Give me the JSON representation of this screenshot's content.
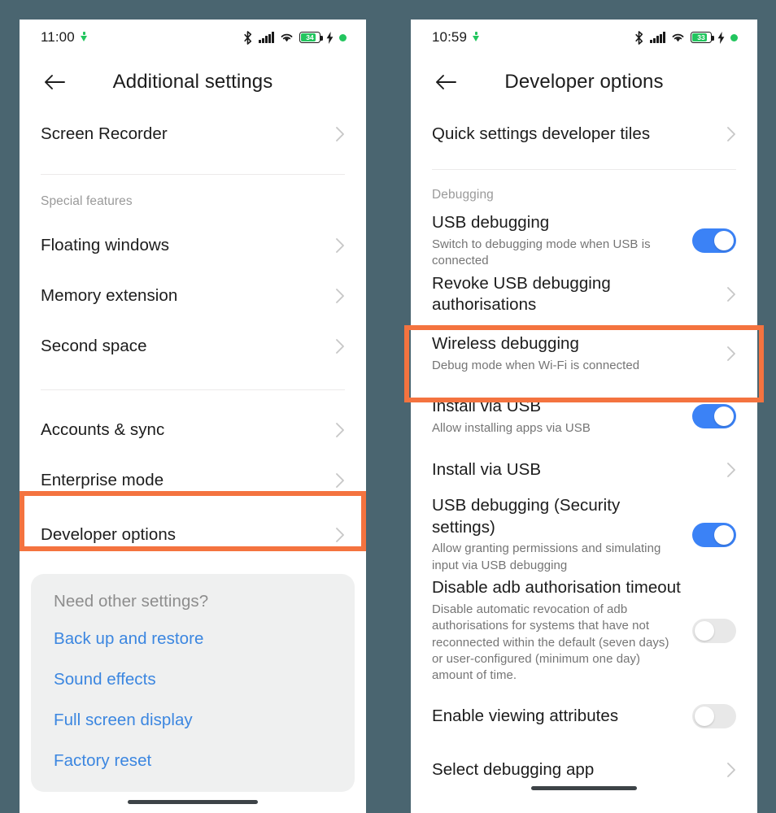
{
  "theme": {
    "background": "#4a6570",
    "panel": "#ffffff",
    "highlight": "#f4733f",
    "toggle_on": "#3b82f6",
    "toggle_off": "#e8e8e8",
    "link": "#3b86e0",
    "battery_fill": "#22c55e"
  },
  "left_phone": {
    "statusbar": {
      "time": "11:00",
      "download_icon": "download-arrow-icon",
      "bluetooth_icon": "bluetooth-icon",
      "signal_icon": "cellular-signal-icon",
      "wifi_icon": "wifi-icon",
      "battery_level": "34",
      "charging_icon": "lightning-bolt-icon",
      "status_dot": "green-dot-icon"
    },
    "appbar": {
      "back_icon": "back-arrow-icon",
      "title": "Additional settings"
    },
    "rows_top": [
      {
        "title": "Screen Recorder",
        "chevron": "chevron-right-icon"
      }
    ],
    "section_label": "Special features",
    "rows_special": [
      {
        "title": "Floating windows",
        "chevron": "chevron-right-icon"
      },
      {
        "title": "Memory extension",
        "chevron": "chevron-right-icon"
      },
      {
        "title": "Second space",
        "chevron": "chevron-right-icon"
      }
    ],
    "rows_bottom": [
      {
        "title": "Accounts & sync",
        "chevron": "chevron-right-icon"
      },
      {
        "title": "Enterprise mode",
        "chevron": "chevron-right-icon"
      },
      {
        "title": "Developer options",
        "chevron": "chevron-right-icon",
        "highlighted": true
      }
    ],
    "need_card": {
      "title": "Need other settings?",
      "links": [
        "Back up and restore",
        "Sound effects",
        "Full screen display",
        "Factory reset"
      ]
    }
  },
  "right_phone": {
    "statusbar": {
      "time": "10:59",
      "download_icon": "download-arrow-icon",
      "bluetooth_icon": "bluetooth-icon",
      "signal_icon": "cellular-signal-icon",
      "wifi_icon": "wifi-icon",
      "battery_level": "33",
      "charging_icon": "lightning-bolt-icon",
      "status_dot": "green-dot-icon"
    },
    "appbar": {
      "back_icon": "back-arrow-icon",
      "title": "Developer options"
    },
    "rows_top": [
      {
        "title": "Quick settings developer tiles",
        "control": "chevron"
      }
    ],
    "section_label": "Debugging",
    "rows_debug": [
      {
        "title": "USB debugging",
        "subtitle": "Switch to debugging mode when USB is connected",
        "control": "toggle",
        "toggle_state": "on"
      },
      {
        "title": "Revoke USB debugging authorisations",
        "subtitle": "",
        "control": "chevron"
      },
      {
        "title": "Wireless debugging",
        "subtitle": "Debug mode when Wi-Fi is connected",
        "control": "chevron",
        "highlighted": true
      },
      {
        "title": "Install via USB",
        "subtitle": "Allow installing apps via USB",
        "control": "toggle",
        "toggle_state": "on"
      },
      {
        "title": "Install via USB",
        "subtitle": "",
        "control": "chevron"
      },
      {
        "title": "USB debugging (Security settings)",
        "subtitle": "Allow granting permissions and simulating input via USB debugging",
        "control": "toggle",
        "toggle_state": "on"
      },
      {
        "title": "Disable adb authorisation timeout",
        "subtitle": "Disable automatic revocation of adb authorisations for systems that have not reconnected within the default (seven days) or user-configured (minimum one day) amount of time.",
        "control": "toggle",
        "toggle_state": "off"
      },
      {
        "title": "Enable viewing attributes",
        "subtitle": "",
        "control": "toggle",
        "toggle_state": "off"
      },
      {
        "title": "Select debugging app",
        "subtitle": "",
        "control": "chevron"
      }
    ]
  }
}
